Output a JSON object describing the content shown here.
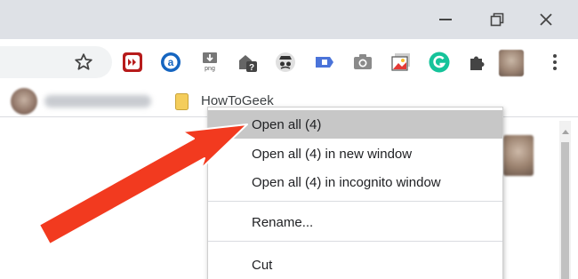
{
  "window": {
    "minimize_icon": "minimize-icon",
    "maximize_icon": "restore-icon",
    "close_icon": "close-icon"
  },
  "toolbar": {
    "star_icon": "bookmark-star-icon",
    "extensions": [
      "video-speed-extension-icon",
      "amazon-assistant-extension-icon",
      "save-as-png-extension-icon",
      "question-extension-icon",
      "incognito-extension-icon",
      "tab-extension-icon",
      "camera-extension-icon",
      "gallery-extension-icon",
      "grammarly-extension-icon",
      "puzzle-extensions-icon"
    ],
    "profile_avatar": "profile-avatar",
    "menu_icon": "kebab-menu-icon"
  },
  "bookmarks_bar": {
    "folder_label": "HowToGeek"
  },
  "context_menu": {
    "items": [
      {
        "label": "Open all (4)",
        "highlighted": true
      },
      {
        "label": "Open all (4) in new window",
        "highlighted": false
      },
      {
        "label": "Open all (4) in incognito window",
        "highlighted": false
      },
      {
        "label": "Rename...",
        "highlighted": false
      },
      {
        "label": "Cut",
        "highlighted": false
      }
    ]
  },
  "colors": {
    "titlebar": "#dee1e6",
    "highlight": "#c7c7c7",
    "arrow": "#f23a1f",
    "folder": "#f4cd5b"
  }
}
